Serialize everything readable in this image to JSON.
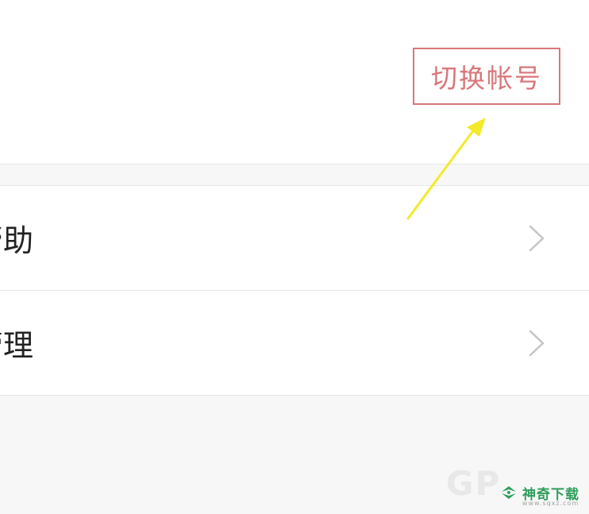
{
  "header": {
    "switch_account_label": "切换帐号"
  },
  "menu": {
    "items": [
      {
        "label": "帮助"
      },
      {
        "label": "管理"
      }
    ]
  },
  "watermark": {
    "ghost_text": "GP",
    "title": "神奇下载",
    "url": "www.sqxz.com"
  },
  "colors": {
    "accent_red": "#d9777a",
    "annotation_yellow": "#f3ea2a",
    "watermark_green": "#2e9e5b"
  }
}
